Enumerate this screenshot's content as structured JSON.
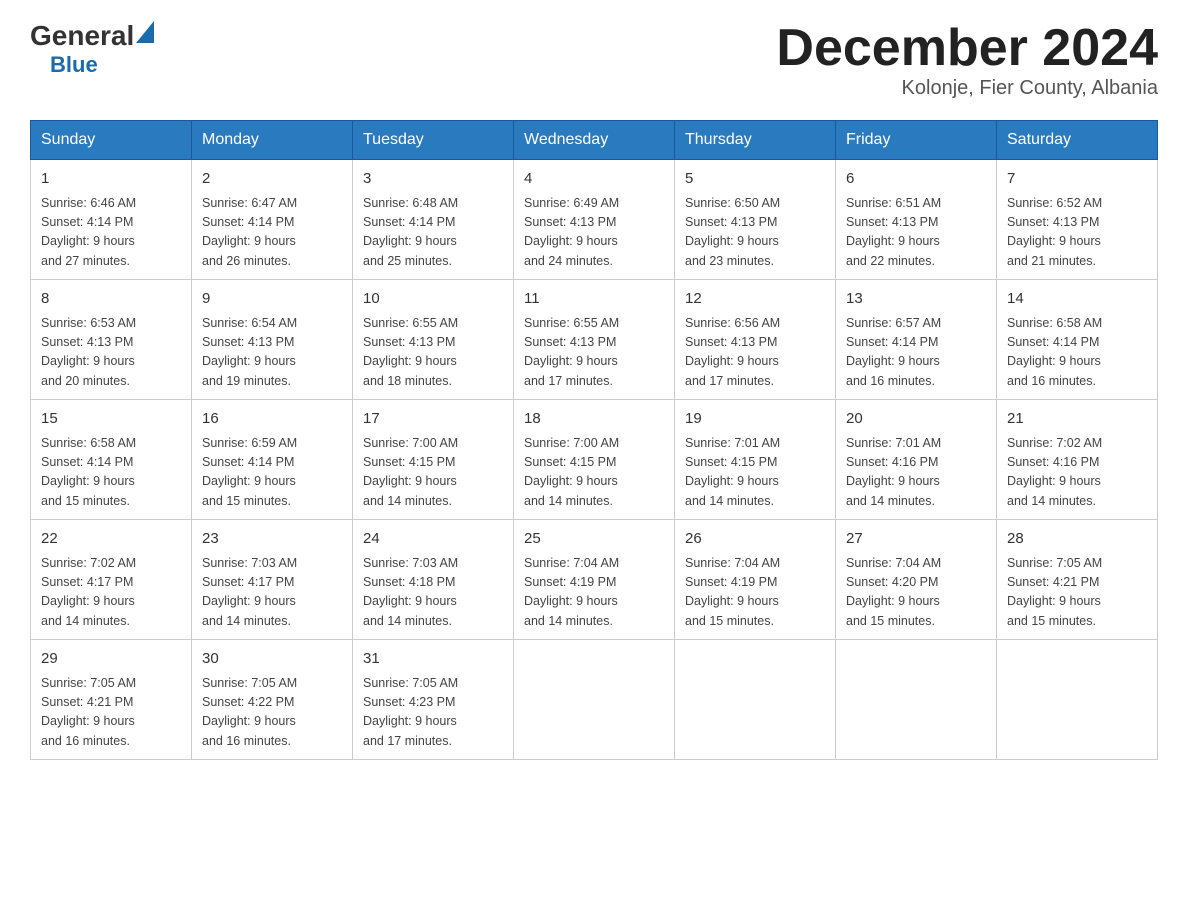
{
  "logo": {
    "general": "General",
    "blue": "Blue"
  },
  "title": "December 2024",
  "subtitle": "Kolonje, Fier County, Albania",
  "days": [
    "Sunday",
    "Monday",
    "Tuesday",
    "Wednesday",
    "Thursday",
    "Friday",
    "Saturday"
  ],
  "weeks": [
    [
      {
        "num": "1",
        "sunrise": "6:46 AM",
        "sunset": "4:14 PM",
        "daylight": "9 hours and 27 minutes."
      },
      {
        "num": "2",
        "sunrise": "6:47 AM",
        "sunset": "4:14 PM",
        "daylight": "9 hours and 26 minutes."
      },
      {
        "num": "3",
        "sunrise": "6:48 AM",
        "sunset": "4:14 PM",
        "daylight": "9 hours and 25 minutes."
      },
      {
        "num": "4",
        "sunrise": "6:49 AM",
        "sunset": "4:13 PM",
        "daylight": "9 hours and 24 minutes."
      },
      {
        "num": "5",
        "sunrise": "6:50 AM",
        "sunset": "4:13 PM",
        "daylight": "9 hours and 23 minutes."
      },
      {
        "num": "6",
        "sunrise": "6:51 AM",
        "sunset": "4:13 PM",
        "daylight": "9 hours and 22 minutes."
      },
      {
        "num": "7",
        "sunrise": "6:52 AM",
        "sunset": "4:13 PM",
        "daylight": "9 hours and 21 minutes."
      }
    ],
    [
      {
        "num": "8",
        "sunrise": "6:53 AM",
        "sunset": "4:13 PM",
        "daylight": "9 hours and 20 minutes."
      },
      {
        "num": "9",
        "sunrise": "6:54 AM",
        "sunset": "4:13 PM",
        "daylight": "9 hours and 19 minutes."
      },
      {
        "num": "10",
        "sunrise": "6:55 AM",
        "sunset": "4:13 PM",
        "daylight": "9 hours and 18 minutes."
      },
      {
        "num": "11",
        "sunrise": "6:55 AM",
        "sunset": "4:13 PM",
        "daylight": "9 hours and 17 minutes."
      },
      {
        "num": "12",
        "sunrise": "6:56 AM",
        "sunset": "4:13 PM",
        "daylight": "9 hours and 17 minutes."
      },
      {
        "num": "13",
        "sunrise": "6:57 AM",
        "sunset": "4:14 PM",
        "daylight": "9 hours and 16 minutes."
      },
      {
        "num": "14",
        "sunrise": "6:58 AM",
        "sunset": "4:14 PM",
        "daylight": "9 hours and 16 minutes."
      }
    ],
    [
      {
        "num": "15",
        "sunrise": "6:58 AM",
        "sunset": "4:14 PM",
        "daylight": "9 hours and 15 minutes."
      },
      {
        "num": "16",
        "sunrise": "6:59 AM",
        "sunset": "4:14 PM",
        "daylight": "9 hours and 15 minutes."
      },
      {
        "num": "17",
        "sunrise": "7:00 AM",
        "sunset": "4:15 PM",
        "daylight": "9 hours and 14 minutes."
      },
      {
        "num": "18",
        "sunrise": "7:00 AM",
        "sunset": "4:15 PM",
        "daylight": "9 hours and 14 minutes."
      },
      {
        "num": "19",
        "sunrise": "7:01 AM",
        "sunset": "4:15 PM",
        "daylight": "9 hours and 14 minutes."
      },
      {
        "num": "20",
        "sunrise": "7:01 AM",
        "sunset": "4:16 PM",
        "daylight": "9 hours and 14 minutes."
      },
      {
        "num": "21",
        "sunrise": "7:02 AM",
        "sunset": "4:16 PM",
        "daylight": "9 hours and 14 minutes."
      }
    ],
    [
      {
        "num": "22",
        "sunrise": "7:02 AM",
        "sunset": "4:17 PM",
        "daylight": "9 hours and 14 minutes."
      },
      {
        "num": "23",
        "sunrise": "7:03 AM",
        "sunset": "4:17 PM",
        "daylight": "9 hours and 14 minutes."
      },
      {
        "num": "24",
        "sunrise": "7:03 AM",
        "sunset": "4:18 PM",
        "daylight": "9 hours and 14 minutes."
      },
      {
        "num": "25",
        "sunrise": "7:04 AM",
        "sunset": "4:19 PM",
        "daylight": "9 hours and 14 minutes."
      },
      {
        "num": "26",
        "sunrise": "7:04 AM",
        "sunset": "4:19 PM",
        "daylight": "9 hours and 15 minutes."
      },
      {
        "num": "27",
        "sunrise": "7:04 AM",
        "sunset": "4:20 PM",
        "daylight": "9 hours and 15 minutes."
      },
      {
        "num": "28",
        "sunrise": "7:05 AM",
        "sunset": "4:21 PM",
        "daylight": "9 hours and 15 minutes."
      }
    ],
    [
      {
        "num": "29",
        "sunrise": "7:05 AM",
        "sunset": "4:21 PM",
        "daylight": "9 hours and 16 minutes."
      },
      {
        "num": "30",
        "sunrise": "7:05 AM",
        "sunset": "4:22 PM",
        "daylight": "9 hours and 16 minutes."
      },
      {
        "num": "31",
        "sunrise": "7:05 AM",
        "sunset": "4:23 PM",
        "daylight": "9 hours and 17 minutes."
      },
      null,
      null,
      null,
      null
    ]
  ]
}
